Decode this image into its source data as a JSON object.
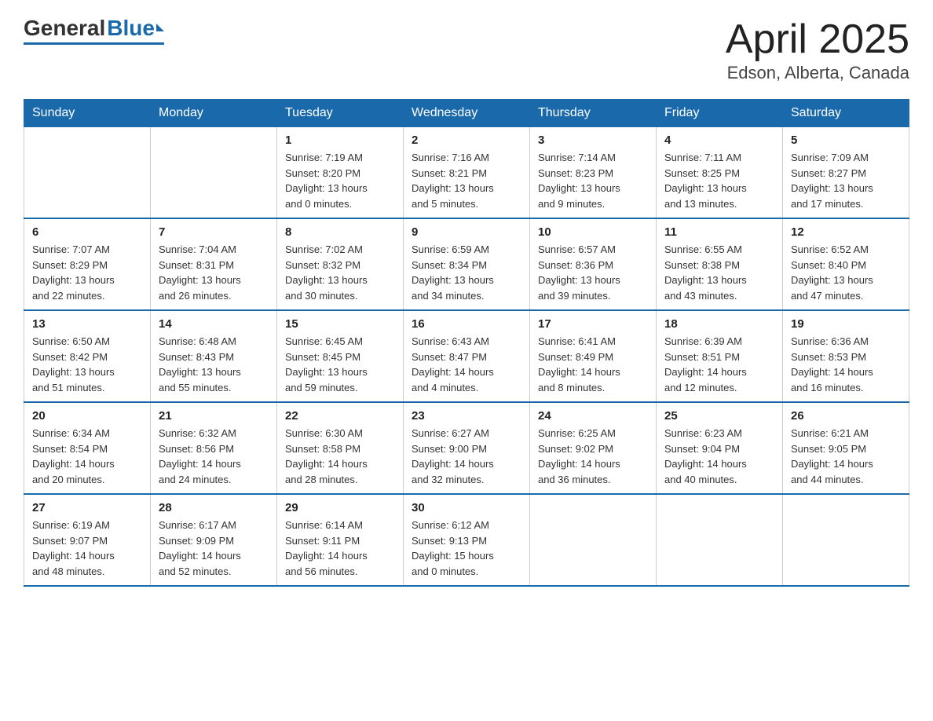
{
  "header": {
    "logo_general": "General",
    "logo_blue": "Blue",
    "month_title": "April 2025",
    "location": "Edson, Alberta, Canada"
  },
  "days_of_week": [
    "Sunday",
    "Monday",
    "Tuesday",
    "Wednesday",
    "Thursday",
    "Friday",
    "Saturday"
  ],
  "weeks": [
    [
      {
        "day": "",
        "info": ""
      },
      {
        "day": "",
        "info": ""
      },
      {
        "day": "1",
        "info": "Sunrise: 7:19 AM\nSunset: 8:20 PM\nDaylight: 13 hours\nand 0 minutes."
      },
      {
        "day": "2",
        "info": "Sunrise: 7:16 AM\nSunset: 8:21 PM\nDaylight: 13 hours\nand 5 minutes."
      },
      {
        "day": "3",
        "info": "Sunrise: 7:14 AM\nSunset: 8:23 PM\nDaylight: 13 hours\nand 9 minutes."
      },
      {
        "day": "4",
        "info": "Sunrise: 7:11 AM\nSunset: 8:25 PM\nDaylight: 13 hours\nand 13 minutes."
      },
      {
        "day": "5",
        "info": "Sunrise: 7:09 AM\nSunset: 8:27 PM\nDaylight: 13 hours\nand 17 minutes."
      }
    ],
    [
      {
        "day": "6",
        "info": "Sunrise: 7:07 AM\nSunset: 8:29 PM\nDaylight: 13 hours\nand 22 minutes."
      },
      {
        "day": "7",
        "info": "Sunrise: 7:04 AM\nSunset: 8:31 PM\nDaylight: 13 hours\nand 26 minutes."
      },
      {
        "day": "8",
        "info": "Sunrise: 7:02 AM\nSunset: 8:32 PM\nDaylight: 13 hours\nand 30 minutes."
      },
      {
        "day": "9",
        "info": "Sunrise: 6:59 AM\nSunset: 8:34 PM\nDaylight: 13 hours\nand 34 minutes."
      },
      {
        "day": "10",
        "info": "Sunrise: 6:57 AM\nSunset: 8:36 PM\nDaylight: 13 hours\nand 39 minutes."
      },
      {
        "day": "11",
        "info": "Sunrise: 6:55 AM\nSunset: 8:38 PM\nDaylight: 13 hours\nand 43 minutes."
      },
      {
        "day": "12",
        "info": "Sunrise: 6:52 AM\nSunset: 8:40 PM\nDaylight: 13 hours\nand 47 minutes."
      }
    ],
    [
      {
        "day": "13",
        "info": "Sunrise: 6:50 AM\nSunset: 8:42 PM\nDaylight: 13 hours\nand 51 minutes."
      },
      {
        "day": "14",
        "info": "Sunrise: 6:48 AM\nSunset: 8:43 PM\nDaylight: 13 hours\nand 55 minutes."
      },
      {
        "day": "15",
        "info": "Sunrise: 6:45 AM\nSunset: 8:45 PM\nDaylight: 13 hours\nand 59 minutes."
      },
      {
        "day": "16",
        "info": "Sunrise: 6:43 AM\nSunset: 8:47 PM\nDaylight: 14 hours\nand 4 minutes."
      },
      {
        "day": "17",
        "info": "Sunrise: 6:41 AM\nSunset: 8:49 PM\nDaylight: 14 hours\nand 8 minutes."
      },
      {
        "day": "18",
        "info": "Sunrise: 6:39 AM\nSunset: 8:51 PM\nDaylight: 14 hours\nand 12 minutes."
      },
      {
        "day": "19",
        "info": "Sunrise: 6:36 AM\nSunset: 8:53 PM\nDaylight: 14 hours\nand 16 minutes."
      }
    ],
    [
      {
        "day": "20",
        "info": "Sunrise: 6:34 AM\nSunset: 8:54 PM\nDaylight: 14 hours\nand 20 minutes."
      },
      {
        "day": "21",
        "info": "Sunrise: 6:32 AM\nSunset: 8:56 PM\nDaylight: 14 hours\nand 24 minutes."
      },
      {
        "day": "22",
        "info": "Sunrise: 6:30 AM\nSunset: 8:58 PM\nDaylight: 14 hours\nand 28 minutes."
      },
      {
        "day": "23",
        "info": "Sunrise: 6:27 AM\nSunset: 9:00 PM\nDaylight: 14 hours\nand 32 minutes."
      },
      {
        "day": "24",
        "info": "Sunrise: 6:25 AM\nSunset: 9:02 PM\nDaylight: 14 hours\nand 36 minutes."
      },
      {
        "day": "25",
        "info": "Sunrise: 6:23 AM\nSunset: 9:04 PM\nDaylight: 14 hours\nand 40 minutes."
      },
      {
        "day": "26",
        "info": "Sunrise: 6:21 AM\nSunset: 9:05 PM\nDaylight: 14 hours\nand 44 minutes."
      }
    ],
    [
      {
        "day": "27",
        "info": "Sunrise: 6:19 AM\nSunset: 9:07 PM\nDaylight: 14 hours\nand 48 minutes."
      },
      {
        "day": "28",
        "info": "Sunrise: 6:17 AM\nSunset: 9:09 PM\nDaylight: 14 hours\nand 52 minutes."
      },
      {
        "day": "29",
        "info": "Sunrise: 6:14 AM\nSunset: 9:11 PM\nDaylight: 14 hours\nand 56 minutes."
      },
      {
        "day": "30",
        "info": "Sunrise: 6:12 AM\nSunset: 9:13 PM\nDaylight: 15 hours\nand 0 minutes."
      },
      {
        "day": "",
        "info": ""
      },
      {
        "day": "",
        "info": ""
      },
      {
        "day": "",
        "info": ""
      }
    ]
  ]
}
